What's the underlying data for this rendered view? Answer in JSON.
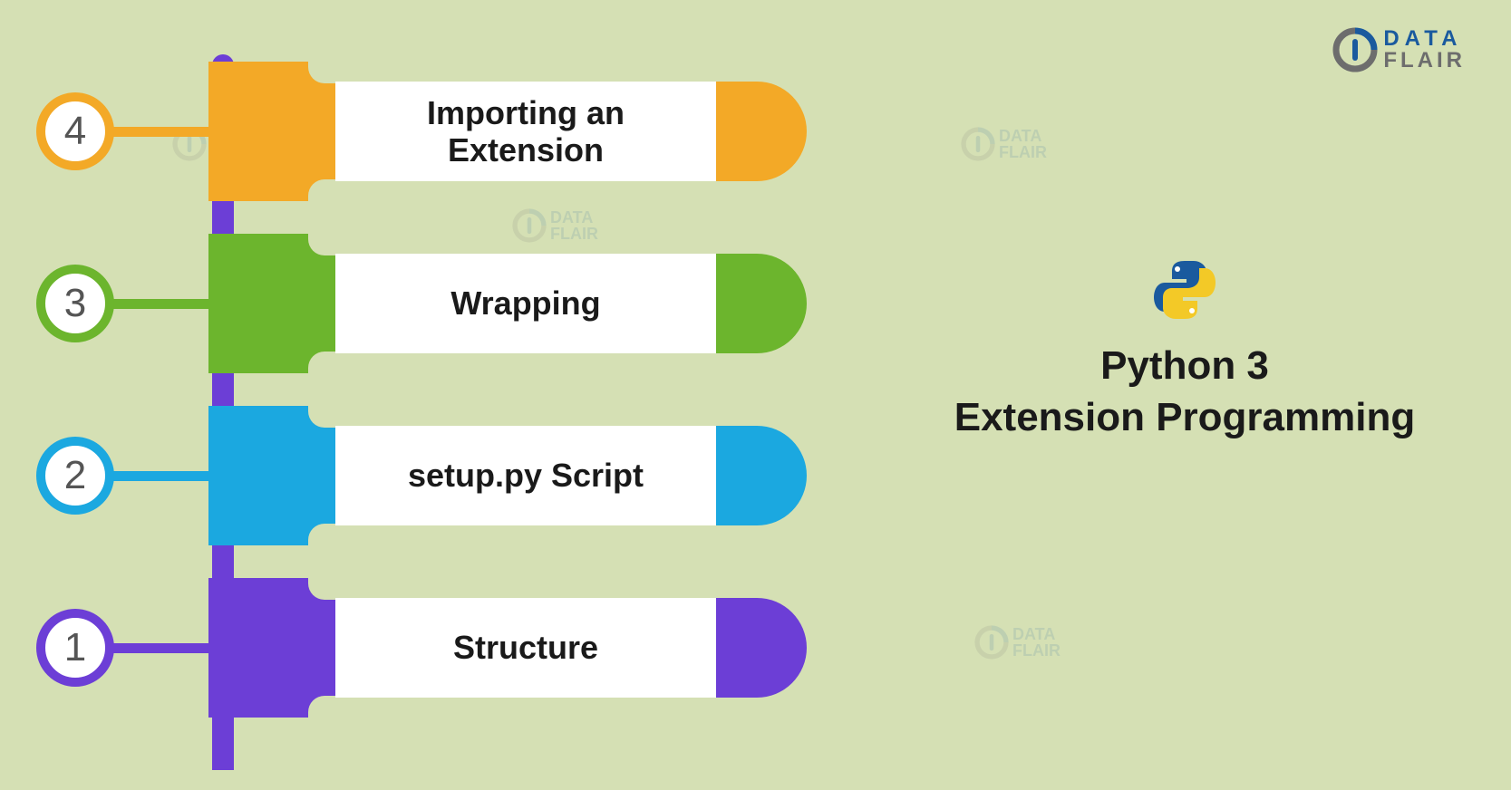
{
  "brand": {
    "name_top": "DATA",
    "name_bottom": "FLAIR"
  },
  "title": {
    "line1": "Python 3",
    "line2": "Extension Programming"
  },
  "steps": [
    {
      "number": "4",
      "label": "Importing an Extension",
      "color": "orange"
    },
    {
      "number": "3",
      "label": "Wrapping",
      "color": "green"
    },
    {
      "number": "2",
      "label": "setup.py Script",
      "color": "blue"
    },
    {
      "number": "1",
      "label": "Structure",
      "color": "purple"
    }
  ],
  "colors": {
    "orange": "#f3a927",
    "green": "#6cb52d",
    "blue": "#1ba8e0",
    "purple": "#6c3ed6",
    "background": "#d5e0b4"
  }
}
